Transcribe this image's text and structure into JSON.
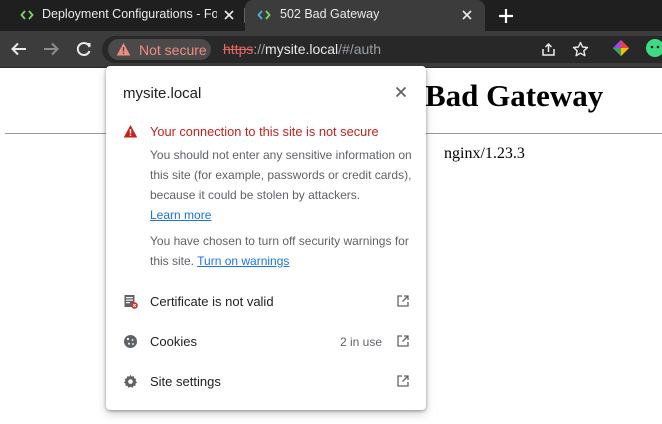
{
  "tabs": [
    {
      "title": "Deployment Configurations - For",
      "active": false
    },
    {
      "title": "502 Bad Gateway",
      "active": true
    }
  ],
  "toolbar": {
    "security_chip": "Not secure",
    "url_scheme": "https",
    "url_sep": "://",
    "url_host": "mysite.local",
    "url_path": "/#/auth"
  },
  "page": {
    "title": "Bad Gateway",
    "server": "nginx/1.23.3"
  },
  "bubble": {
    "host": "mysite.local",
    "warning_title": "Your connection to this site is not secure",
    "warning_body": "You should not enter any sensitive information on this site (for example, passwords or credit cards), because it could be stolen by attackers.",
    "learn_more": "Learn more",
    "override_text": "You have chosen to turn off security warnings for this site.",
    "turn_on_link": "Turn on warnings",
    "rows": [
      {
        "label": "Certificate is not valid",
        "meta": ""
      },
      {
        "label": "Cookies",
        "meta": "2 in use"
      },
      {
        "label": "Site settings",
        "meta": ""
      }
    ]
  },
  "colors": {
    "danger": "#c5221f",
    "link": "#1a73e8",
    "chip_text": "#f28b82",
    "tab_active_bg": "#3c3c3c",
    "tabstrip_bg": "#1f1f1f"
  }
}
